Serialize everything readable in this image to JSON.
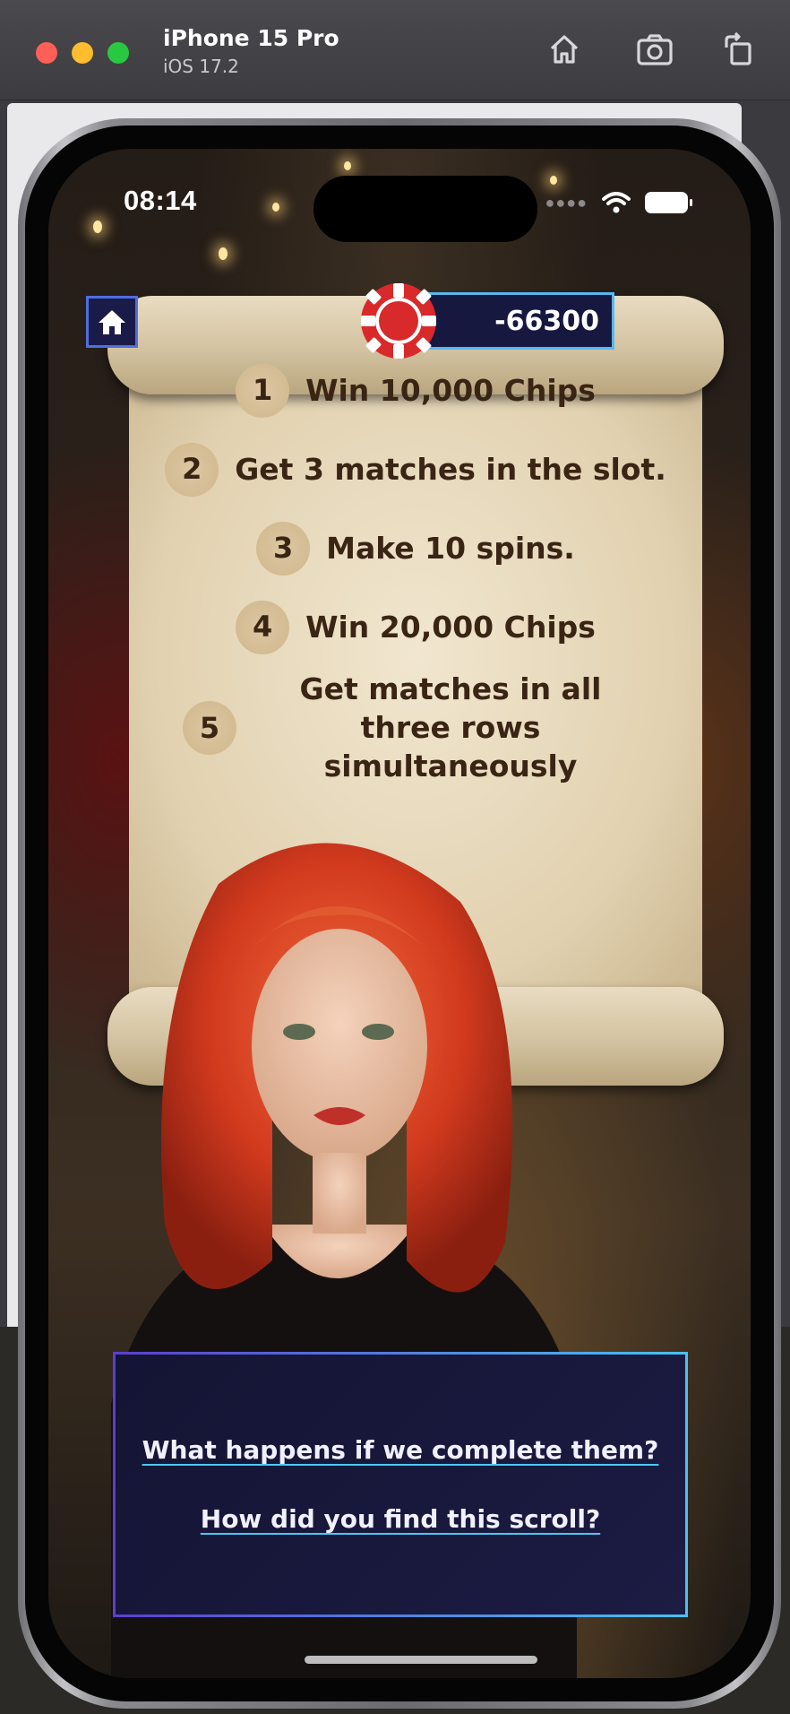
{
  "simulator": {
    "device_name": "iPhone 15 Pro",
    "os_version": "iOS 17.2"
  },
  "status_bar": {
    "time": "08:14"
  },
  "header": {
    "chip_balance": "-66300"
  },
  "quests": [
    {
      "number": "1",
      "text": "Win 10,000 Chips"
    },
    {
      "number": "2",
      "text": "Get 3 matches in the slot."
    },
    {
      "number": "3",
      "text": "Make 10 spins."
    },
    {
      "number": "4",
      "text": "Win 20,000 Chips"
    },
    {
      "number": "5",
      "text": "Get matches in all three rows simultaneously"
    }
  ],
  "dialog": {
    "option_1": "What happens if we complete them?",
    "option_2": "How did you find this scroll?"
  },
  "colors": {
    "panel_bg": "#171840",
    "accent_blue": "#4bc0f2",
    "accent_purple": "#5a3fd0",
    "scroll_text": "#3a2414",
    "chip_red": "#d82a2a"
  }
}
